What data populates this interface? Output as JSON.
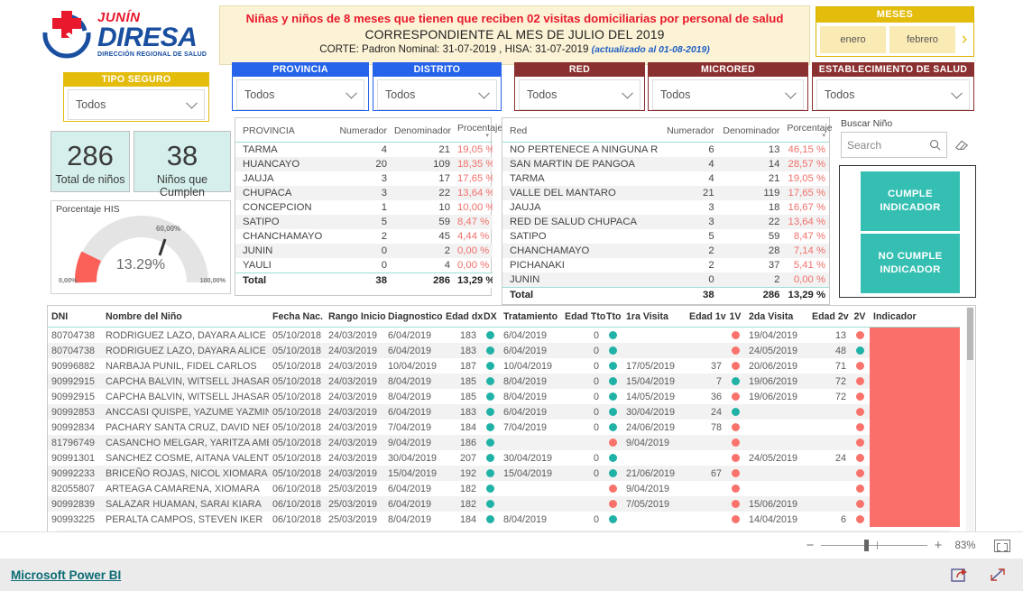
{
  "logo": {
    "brand_top": "JUNÍN",
    "brand_main": "DIRESA",
    "brand_sub": "DIRECCIÓN REGIONAL DE SALUD"
  },
  "title": {
    "line1": "Niñas y niños de 8 meses que tienen que reciben 02 visitas domiciliarias por personal de salud",
    "line2": "CORRESPONDIENTE AL MES DE JULIO DEL 2019",
    "line3": "CORTE: Padron Nominal: 31-07-2019 ,  HISA: 31-07-2019",
    "updated": "(actualizado al  01-08-2019)"
  },
  "meses": {
    "header": "MESES",
    "items": [
      "enero",
      "febrero"
    ],
    "next_icon": "chevron-right-icon"
  },
  "slicers": [
    {
      "key": "tipo_seguro",
      "header": "TIPO SEGURO",
      "value": "Todos",
      "color": "#e3bc0c"
    },
    {
      "key": "provincia",
      "header": "PROVINCIA",
      "value": "Todos",
      "color": "#2563eb"
    },
    {
      "key": "distrito",
      "header": "DISTRITO",
      "value": "Todos",
      "color": "#2563eb"
    },
    {
      "key": "red",
      "header": "RED",
      "value": "Todos",
      "color": "#8b3030"
    },
    {
      "key": "microred",
      "header": "MICRORED",
      "value": "Todos",
      "color": "#8b3030"
    },
    {
      "key": "establecimiento",
      "header": "ESTABLECIMIENTO DE SALUD",
      "value": "Todos",
      "color": "#8b3030"
    }
  ],
  "kpis": [
    {
      "value": "286",
      "label": "Total de niños"
    },
    {
      "value": "38",
      "label": "Niños que Cumplen"
    }
  ],
  "gauge": {
    "title": "Porcentaje HIS",
    "value_label": "13.29%",
    "min_label": "0,00%",
    "max_label": "100,00%",
    "target_label": "60,00%",
    "value": 13.29,
    "target": 60,
    "min": 0,
    "max": 100,
    "fill_color": "#fb6058",
    "track_color": "#e4e4e4"
  },
  "provincia_table": {
    "columns": [
      "PROVINCIA",
      "Numerador",
      "Denominador",
      "Procentaje"
    ],
    "rows": [
      [
        "TARMA",
        "4",
        "21",
        "19,05 %"
      ],
      [
        "HUANCAYO",
        "20",
        "109",
        "18,35 %"
      ],
      [
        "JAUJA",
        "3",
        "17",
        "17,65 %"
      ],
      [
        "CHUPACA",
        "3",
        "22",
        "13,64 %"
      ],
      [
        "CONCEPCION",
        "1",
        "10",
        "10,00 %"
      ],
      [
        "SATIPO",
        "5",
        "59",
        "8,47 %"
      ],
      [
        "CHANCHAMAYO",
        "2",
        "45",
        "4,44 %"
      ],
      [
        "JUNIN",
        "0",
        "2",
        "0,00 %"
      ],
      [
        "YAULI",
        "0",
        "4",
        "0,00 %"
      ]
    ],
    "total": [
      "Total",
      "38",
      "286",
      "13,29 %"
    ]
  },
  "red_table": {
    "columns": [
      "Red",
      "Numerador",
      "Denominador",
      "Porcentaje"
    ],
    "rows": [
      [
        "NO PERTENECE A NINGUNA RED",
        "6",
        "13",
        "46,15 %"
      ],
      [
        "SAN MARTIN DE PANGOA",
        "4",
        "14",
        "28,57 %"
      ],
      [
        "TARMA",
        "4",
        "21",
        "19,05 %"
      ],
      [
        "VALLE DEL MANTARO",
        "21",
        "119",
        "17,65 %"
      ],
      [
        "JAUJA",
        "3",
        "18",
        "16,67 %"
      ],
      [
        "RED DE SALUD CHUPACA",
        "3",
        "22",
        "13,64 %"
      ],
      [
        "SATIPO",
        "5",
        "59",
        "8,47 %"
      ],
      [
        "CHANCHAMAYO",
        "2",
        "28",
        "7,14 %"
      ],
      [
        "PICHANAKI",
        "2",
        "37",
        "5,41 %"
      ],
      [
        "JUNIN",
        "0",
        "2",
        "0,00 %"
      ]
    ],
    "total": [
      "Total",
      "38",
      "286",
      "13,29 %"
    ]
  },
  "search": {
    "label": "Buscar Niño",
    "placeholder": "Search",
    "search_icon": "search-icon",
    "clear_icon": "eraser-icon"
  },
  "indicator_buttons": [
    {
      "line1": "CUMPLE",
      "line2": "INDICADOR"
    },
    {
      "line1": "NO CUMPLE",
      "line2": "INDICADOR"
    }
  ],
  "data_table": {
    "columns": [
      "DNI",
      "Nombre del Niño",
      "Fecha Nac.",
      "Rango Inicio",
      "Diagnostico",
      "Edad dx",
      "DX",
      "Tratamiento",
      "Edad Tto",
      "Tto",
      "1ra Visita",
      "Edad 1v",
      "1V",
      "2da Visita",
      "Edad 2v",
      "2V",
      "Indicador"
    ],
    "rows": [
      {
        "dni": "80704738",
        "nombre": "RODRIGUEZ LAZO, DAYARA ALICE",
        "fecha_nac": "05/10/2018",
        "rango_inicio": "24/03/2019",
        "diagnostico": "6/04/2019",
        "edad_dx": "183",
        "dx": "g",
        "tratamiento": "6/04/2019",
        "edad_tto": "0",
        "tto": "g",
        "visita1": "",
        "edad_1v": "",
        "v1": "r",
        "visita2": "19/04/2019",
        "edad_2v": "13",
        "v2": "r",
        "indicador": "no"
      },
      {
        "dni": "80704738",
        "nombre": "RODRIGUEZ LAZO, DAYARA ALICE",
        "fecha_nac": "05/10/2018",
        "rango_inicio": "24/03/2019",
        "diagnostico": "6/04/2019",
        "edad_dx": "183",
        "dx": "g",
        "tratamiento": "6/04/2019",
        "edad_tto": "0",
        "tto": "g",
        "visita1": "",
        "edad_1v": "",
        "v1": "r",
        "visita2": "24/05/2019",
        "edad_2v": "48",
        "v2": "g",
        "indicador": "no"
      },
      {
        "dni": "90996882",
        "nombre": "NARBAJA PUNIL, FIDEL CARLOS",
        "fecha_nac": "05/10/2018",
        "rango_inicio": "24/03/2019",
        "diagnostico": "10/04/2019",
        "edad_dx": "187",
        "dx": "g",
        "tratamiento": "10/04/2019",
        "edad_tto": "0",
        "tto": "g",
        "visita1": "17/05/2019",
        "edad_1v": "37",
        "v1": "r",
        "visita2": "20/06/2019",
        "edad_2v": "71",
        "v2": "r",
        "indicador": "no"
      },
      {
        "dni": "90992915",
        "nombre": "CAPCHA BALVIN, WITSELL JHASAR",
        "fecha_nac": "05/10/2018",
        "rango_inicio": "24/03/2019",
        "diagnostico": "8/04/2019",
        "edad_dx": "185",
        "dx": "g",
        "tratamiento": "8/04/2019",
        "edad_tto": "0",
        "tto": "g",
        "visita1": "15/04/2019",
        "edad_1v": "7",
        "v1": "g",
        "visita2": "19/06/2019",
        "edad_2v": "72",
        "v2": "r",
        "indicador": "no"
      },
      {
        "dni": "90992915",
        "nombre": "CAPCHA BALVIN, WITSELL JHASAR",
        "fecha_nac": "05/10/2018",
        "rango_inicio": "24/03/2019",
        "diagnostico": "8/04/2019",
        "edad_dx": "185",
        "dx": "g",
        "tratamiento": "8/04/2019",
        "edad_tto": "0",
        "tto": "g",
        "visita1": "14/05/2019",
        "edad_1v": "36",
        "v1": "r",
        "visita2": "19/06/2019",
        "edad_2v": "72",
        "v2": "r",
        "indicador": "no"
      },
      {
        "dni": "90992853",
        "nombre": "ANCCASI QUISPE, YAZUME YAZMIN",
        "fecha_nac": "05/10/2018",
        "rango_inicio": "24/03/2019",
        "diagnostico": "6/04/2019",
        "edad_dx": "183",
        "dx": "g",
        "tratamiento": "6/04/2019",
        "edad_tto": "0",
        "tto": "g",
        "visita1": "30/04/2019",
        "edad_1v": "24",
        "v1": "g",
        "visita2": "",
        "edad_2v": "",
        "v2": "r",
        "indicador": "no"
      },
      {
        "dni": "90992834",
        "nombre": "PACHARY SANTA CRUZ, DAVID NEFTALI",
        "fecha_nac": "05/10/2018",
        "rango_inicio": "24/03/2019",
        "diagnostico": "7/04/2019",
        "edad_dx": "184",
        "dx": "g",
        "tratamiento": "7/04/2019",
        "edad_tto": "0",
        "tto": "g",
        "visita1": "24/06/2019",
        "edad_1v": "78",
        "v1": "r",
        "visita2": "",
        "edad_2v": "",
        "v2": "r",
        "indicador": "no"
      },
      {
        "dni": "81796749",
        "nombre": "CASANCHO MELGAR, YARITZA AMELIA",
        "fecha_nac": "05/10/2018",
        "rango_inicio": "24/03/2019",
        "diagnostico": "9/04/2019",
        "edad_dx": "186",
        "dx": "g",
        "tratamiento": "",
        "edad_tto": "",
        "tto": "r",
        "visita1": "9/04/2019",
        "edad_1v": "",
        "v1": "r",
        "visita2": "",
        "edad_2v": "",
        "v2": "r",
        "indicador": "no"
      },
      {
        "dni": "90991301",
        "nombre": "SANCHEZ COSME, AITANA VALENTINA",
        "fecha_nac": "05/10/2018",
        "rango_inicio": "24/03/2019",
        "diagnostico": "30/04/2019",
        "edad_dx": "207",
        "dx": "g",
        "tratamiento": "30/04/2019",
        "edad_tto": "0",
        "tto": "g",
        "visita1": "",
        "edad_1v": "",
        "v1": "r",
        "visita2": "24/05/2019",
        "edad_2v": "24",
        "v2": "r",
        "indicador": "no"
      },
      {
        "dni": "90992233",
        "nombre": "BRICEÑO ROJAS, NICOL XIOMARA",
        "fecha_nac": "05/10/2018",
        "rango_inicio": "24/03/2019",
        "diagnostico": "15/04/2019",
        "edad_dx": "192",
        "dx": "g",
        "tratamiento": "15/04/2019",
        "edad_tto": "0",
        "tto": "g",
        "visita1": "21/06/2019",
        "edad_1v": "67",
        "v1": "r",
        "visita2": "",
        "edad_2v": "",
        "v2": "r",
        "indicador": "no"
      },
      {
        "dni": "82055807",
        "nombre": "ARTEAGA CAMARENA, XIOMARA",
        "fecha_nac": "06/10/2018",
        "rango_inicio": "25/03/2019",
        "diagnostico": "6/04/2019",
        "edad_dx": "182",
        "dx": "g",
        "tratamiento": "",
        "edad_tto": "",
        "tto": "r",
        "visita1": "9/04/2019",
        "edad_1v": "",
        "v1": "r",
        "visita2": "",
        "edad_2v": "",
        "v2": "r",
        "indicador": "no"
      },
      {
        "dni": "90992839",
        "nombre": "SALAZAR HUAMAN, SARAI KIARA",
        "fecha_nac": "06/10/2018",
        "rango_inicio": "25/03/2019",
        "diagnostico": "6/04/2019",
        "edad_dx": "182",
        "dx": "g",
        "tratamiento": "",
        "edad_tto": "",
        "tto": "r",
        "visita1": "7/05/2019",
        "edad_1v": "",
        "v1": "r",
        "visita2": "15/06/2019",
        "edad_2v": "",
        "v2": "r",
        "indicador": "no"
      },
      {
        "dni": "90993225",
        "nombre": "PERALTA CAMPOS, STEVEN IKER",
        "fecha_nac": "06/10/2018",
        "rango_inicio": "25/03/2019",
        "diagnostico": "8/04/2019",
        "edad_dx": "184",
        "dx": "g",
        "tratamiento": "8/04/2019",
        "edad_tto": "0",
        "tto": "g",
        "visita1": "",
        "edad_1v": "",
        "v1": "r",
        "visita2": "14/04/2019",
        "edad_2v": "6",
        "v2": "r",
        "indicador": "no"
      }
    ]
  },
  "statusbar": {
    "zoom_out_icon": "minus-icon",
    "zoom_in_icon": "plus-icon",
    "zoom_level": "83%",
    "fit_icon": "fit-to-page-icon"
  },
  "footer": {
    "link": "Microsoft Power BI",
    "share_icon": "share-icon",
    "fullscreen_icon": "fullscreen-icon"
  },
  "colors": {
    "accent_teal": "#35bfb2",
    "accent_red": "#fb6f6b",
    "blue_header": "#2563eb",
    "maroon_header": "#8b3030",
    "gold_header": "#e3bc0c",
    "kpi_bg": "#d5f0ec"
  }
}
